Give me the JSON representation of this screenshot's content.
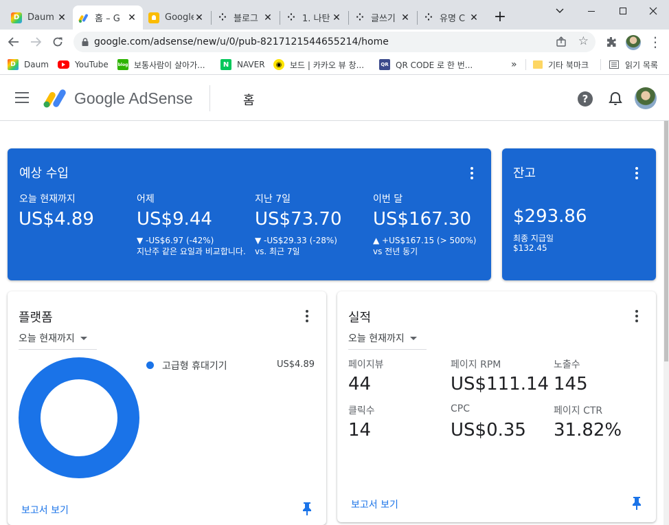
{
  "browser": {
    "tabs": [
      {
        "title": "Daum",
        "icon": "daum-icon",
        "active": false
      },
      {
        "title": "홈 – G",
        "icon": "adsense-icon",
        "active": true
      },
      {
        "title": "Google",
        "icon": "google-keep-icon",
        "active": false
      },
      {
        "title": "블로그",
        "icon": "tistory-icon",
        "active": false
      },
      {
        "title": "1. 나탄",
        "icon": "tistory-icon",
        "active": false
      },
      {
        "title": "글쓰기",
        "icon": "tistory-icon",
        "active": false
      },
      {
        "title": "유명 C",
        "icon": "tistory-icon",
        "active": false
      }
    ],
    "new_tab": "+",
    "close_glyph": "✕",
    "url": "google.com/adsense/new/u/0/pub-8217121544655214/home",
    "bookmarks": [
      {
        "label": "Daum",
        "icon": "daum-icon"
      },
      {
        "label": "YouTube",
        "icon": "youtube-icon"
      },
      {
        "label": "보통사람이 살아가...",
        "icon": "blog-icon"
      },
      {
        "label": "NAVER",
        "icon": "naver-icon"
      },
      {
        "label": "보드 | 카카오 뷰 창...",
        "icon": "kakao-view-icon"
      },
      {
        "label": "QR CODE 로 한 번...",
        "icon": "qr-icon"
      }
    ],
    "bookmarks_overflow": "»",
    "other_bookmarks": "기타 북마크",
    "reading_list": "읽기 목록"
  },
  "app": {
    "logo_text": "Google AdSense",
    "page_title": "홈"
  },
  "earnings": {
    "title": "예상 수입",
    "metrics": [
      {
        "label": "오늘 현재까지",
        "value": "US$4.89",
        "change": "",
        "compare": ""
      },
      {
        "label": "어제",
        "value": "US$9.44",
        "change": "▼ -US$6.97 (-42%)",
        "compare": "지난주 같은 요일과 비교합니다."
      },
      {
        "label": "지난 7일",
        "value": "US$73.70",
        "change": "▼ -US$29.33 (-28%)",
        "compare": "vs. 최근 7일"
      },
      {
        "label": "이번 달",
        "value": "US$167.30",
        "change": "▲ +US$167.15 (> 500%)",
        "compare": "vs 전년 동기"
      }
    ]
  },
  "balance": {
    "title": "잔고",
    "value": "$293.86",
    "last_payment_label": "최종 지급일",
    "last_payment_value": "$132.45"
  },
  "platform": {
    "title": "플랫폼",
    "range": "오늘 현재까지",
    "legend": [
      {
        "label": "고급형 휴대기기",
        "value": "US$4.89",
        "color": "#1a73e8"
      }
    ],
    "report_link": "보고서 보기"
  },
  "performance": {
    "title": "실적",
    "range": "오늘 현재까지",
    "metrics": [
      {
        "label": "페이지뷰",
        "value": "44"
      },
      {
        "label": "페이지 RPM",
        "value": "US$111.14"
      },
      {
        "label": "노출수",
        "value": "145"
      },
      {
        "label": "클릭수",
        "value": "14"
      },
      {
        "label": "CPC",
        "value": "US$0.35"
      },
      {
        "label": "페이지 CTR",
        "value": "31.82%"
      }
    ],
    "report_link": "보고서 보기"
  },
  "colors": {
    "brand_blue": "#1967d2",
    "link_blue": "#1a73e8",
    "donut": "#1a73e8"
  }
}
